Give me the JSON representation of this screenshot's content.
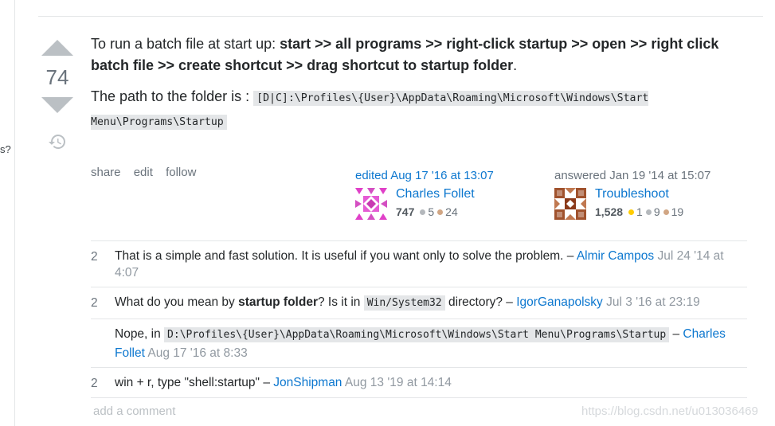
{
  "sidebar_fragment": "s?",
  "vote": {
    "count": "74"
  },
  "answer": {
    "p1_prefix": "To run a batch file at start up: ",
    "p1_bold": "start >> all programs >> right-click startup >> open >> right click batch file >> create shortcut >> drag shortcut to startup folder",
    "p1_suffix": ".",
    "p2_prefix": "The path to the folder is : ",
    "p2_code": "[D|C]:\\Profiles\\{User}\\AppData\\Roaming\\Microsoft\\Windows\\Start Menu\\Programs\\Startup"
  },
  "menu": {
    "share": "share",
    "edit": "edit",
    "follow": "follow"
  },
  "editor": {
    "action": "edited Aug 17 '16 at 13:07",
    "name": "Charles Follet",
    "rep": "747",
    "silver": "5",
    "bronze": "24"
  },
  "author": {
    "action": "answered Jan 19 '14 at 15:07",
    "name": "Troubleshoot",
    "rep": "1,528",
    "gold": "1",
    "silver": "9",
    "bronze": "19"
  },
  "comments": [
    {
      "score": "2",
      "text": "That is a simple and fast solution. It is useful if you want only to solve the problem. – ",
      "user": "Almir Campos",
      "date": "Jul 24 '14 at 4:07"
    },
    {
      "score": "2",
      "text_a": "What do you mean by ",
      "bold": "startup folder",
      "text_b": "? Is it in ",
      "code": "Win/System32",
      "text_c": " directory? – ",
      "user": "IgorGanapolsky",
      "date": "Jul 3 '16 at 23:19"
    },
    {
      "score": "",
      "text_a": "Nope, in ",
      "code": "D:\\Profiles\\{User}\\AppData\\Roaming\\Microsoft\\Windows\\Start Menu\\Programs\\Startup",
      "text_b": " – ",
      "user": "Charles Follet",
      "date": "Aug 17 '16 at 8:33"
    },
    {
      "score": "2",
      "text": "win + r, type \"shell:startup\" – ",
      "user": "JonShipman",
      "date": "Aug 13 '19 at 14:14"
    }
  ],
  "add_comment": "add a comment",
  "watermark": "https://blog.csdn.net/u013036469",
  "colors": {
    "link": "#0c77cf",
    "muted": "#6a737c",
    "gold": "#ffcc01",
    "silver": "#b4b8bc",
    "bronze": "#d1a684"
  }
}
